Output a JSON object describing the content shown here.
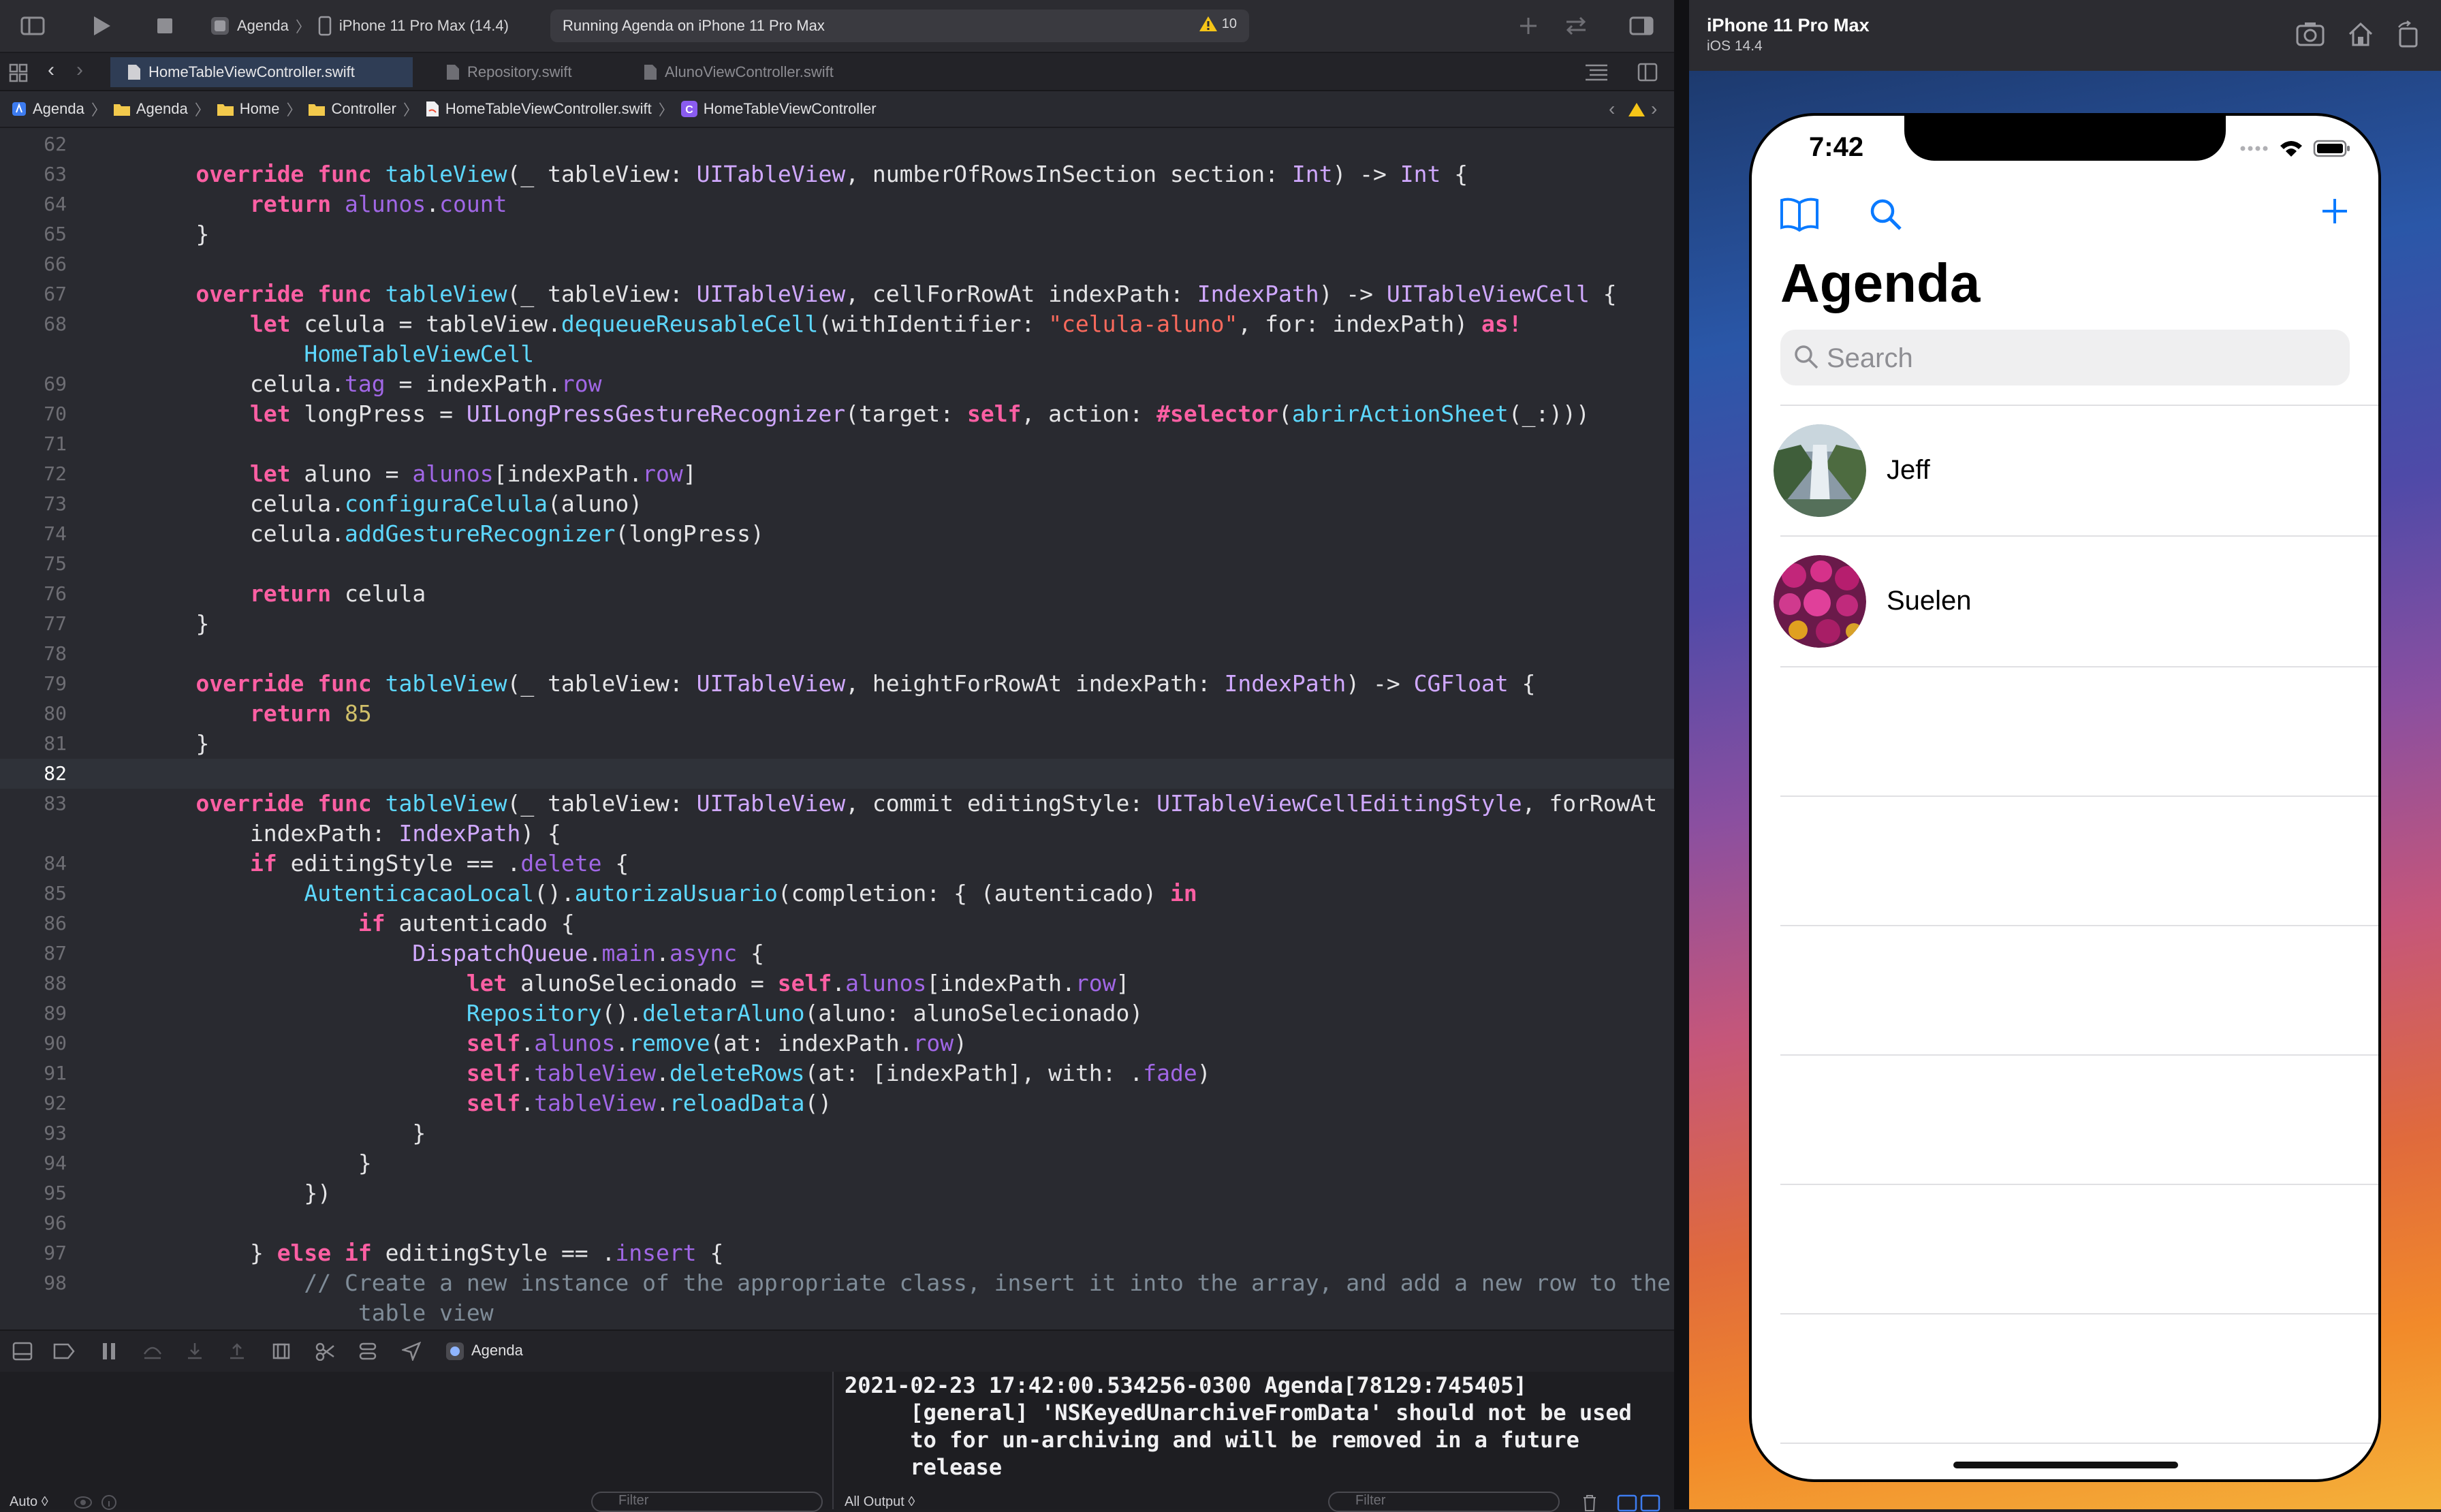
{
  "toolbar": {
    "scheme_project": "Agenda",
    "scheme_device": "iPhone 11 Pro Max (14.4)",
    "status": "Running Agenda on iPhone 11 Pro Max",
    "warning_count": "10"
  },
  "tabs": [
    {
      "label": "HomeTableViewController.swift"
    },
    {
      "label": "Repository.swift"
    },
    {
      "label": "AlunoViewController.swift"
    }
  ],
  "jumpbar": {
    "items": [
      "Agenda",
      "Agenda",
      "Home",
      "Controller",
      "HomeTableViewController.swift",
      "HomeTableViewController"
    ]
  },
  "debug": {
    "target": "Agenda"
  },
  "console": {
    "output": "2021-02-23 17:42:00.534256-0300 Agenda[78129:745405]\n     [general] 'NSKeyedUnarchiveFromData' should not be used\n     to for un-archiving and will be removed in a future\n     release",
    "left_scope": "Auto ◊",
    "right_scope": "All Output ◊",
    "filter_placeholder": "Filter"
  },
  "simulator": {
    "device": "iPhone 11 Pro Max",
    "os": "iOS 14.4",
    "time": "7:42",
    "title": "Agenda",
    "search_placeholder": "Search",
    "contacts": [
      {
        "name": "Jeff"
      },
      {
        "name": "Suelen"
      }
    ]
  },
  "colors": {
    "accent": "#0a7aff",
    "keyword": "#fc5fa3",
    "function": "#5dd8ff",
    "type": "#d0a8ff",
    "string": "#fc6a5d",
    "number": "#d0bf69",
    "comment": "#7f8c98"
  },
  "code_lines": [
    {
      "n": "62",
      "c": []
    },
    {
      "n": "63",
      "c": [
        [
          "",
          "    "
        ],
        [
          "kw",
          "override"
        ],
        [
          "",
          " "
        ],
        [
          "kw",
          "func"
        ],
        [
          "",
          " "
        ],
        [
          "fn",
          "tableView"
        ],
        [
          "",
          "(_ tableView: "
        ],
        [
          "ty",
          "UITableView"
        ],
        [
          "",
          ", numberOfRowsInSection section: "
        ],
        [
          "ty",
          "Int"
        ],
        [
          "",
          ") -> "
        ],
        [
          "ty",
          "Int"
        ],
        [
          "",
          " {"
        ]
      ]
    },
    {
      "n": "64",
      "c": [
        [
          "",
          "        "
        ],
        [
          "kw",
          "return"
        ],
        [
          "",
          " "
        ],
        [
          "pr",
          "alunos"
        ],
        [
          "",
          "."
        ],
        [
          "pr",
          "count"
        ]
      ]
    },
    {
      "n": "65",
      "c": [
        [
          "",
          "    }"
        ]
      ]
    },
    {
      "n": "66",
      "c": []
    },
    {
      "n": "67",
      "c": [
        [
          "",
          "    "
        ],
        [
          "kw",
          "override"
        ],
        [
          "",
          " "
        ],
        [
          "kw",
          "func"
        ],
        [
          "",
          " "
        ],
        [
          "fn",
          "tableView"
        ],
        [
          "",
          "(_ tableView: "
        ],
        [
          "ty",
          "UITableView"
        ],
        [
          "",
          ", cellForRowAt indexPath: "
        ],
        [
          "ty",
          "IndexPath"
        ],
        [
          "",
          ") -> "
        ],
        [
          "ty",
          "UITableViewCell"
        ],
        [
          "",
          " {"
        ]
      ]
    },
    {
      "n": "68",
      "c": [
        [
          "",
          "        "
        ],
        [
          "kw",
          "let"
        ],
        [
          "",
          " celula = tableView."
        ],
        [
          "fn",
          "dequeueReusableCell"
        ],
        [
          "",
          "(withIdentifier: "
        ],
        [
          "st",
          "\"celula-aluno\""
        ],
        [
          "",
          ", for: indexPath) "
        ],
        [
          "kw",
          "as!"
        ]
      ]
    },
    {
      "n": "",
      "c": [
        [
          "",
          "            "
        ],
        [
          "fn",
          "HomeTableViewCell"
        ]
      ]
    },
    {
      "n": "69",
      "c": [
        [
          "",
          "        celula."
        ],
        [
          "pr",
          "tag"
        ],
        [
          "",
          " = indexPath."
        ],
        [
          "pr",
          "row"
        ]
      ]
    },
    {
      "n": "70",
      "c": [
        [
          "",
          "        "
        ],
        [
          "kw",
          "let"
        ],
        [
          "",
          " longPress = "
        ],
        [
          "ty",
          "UILongPressGestureRecognizer"
        ],
        [
          "",
          "(target: "
        ],
        [
          "kw",
          "self"
        ],
        [
          "",
          ", action: "
        ],
        [
          "kw",
          "#selector"
        ],
        [
          "",
          "("
        ],
        [
          "fn",
          "abrirActionSheet"
        ],
        [
          "",
          "(_:)))"
        ]
      ]
    },
    {
      "n": "71",
      "c": []
    },
    {
      "n": "72",
      "c": [
        [
          "",
          "        "
        ],
        [
          "kw",
          "let"
        ],
        [
          "",
          " aluno = "
        ],
        [
          "pr",
          "alunos"
        ],
        [
          "",
          "[indexPath."
        ],
        [
          "pr",
          "row"
        ],
        [
          "",
          "]"
        ]
      ]
    },
    {
      "n": "73",
      "c": [
        [
          "",
          "        celula."
        ],
        [
          "fn",
          "configuraCelula"
        ],
        [
          "",
          "(aluno)"
        ]
      ]
    },
    {
      "n": "74",
      "c": [
        [
          "",
          "        celula."
        ],
        [
          "fn",
          "addGestureRecognizer"
        ],
        [
          "",
          "(longPress)"
        ]
      ]
    },
    {
      "n": "75",
      "c": []
    },
    {
      "n": "76",
      "c": [
        [
          "",
          "        "
        ],
        [
          "kw",
          "return"
        ],
        [
          "",
          " celula"
        ]
      ]
    },
    {
      "n": "77",
      "c": [
        [
          "",
          "    }"
        ]
      ]
    },
    {
      "n": "78",
      "c": []
    },
    {
      "n": "79",
      "c": [
        [
          "",
          "    "
        ],
        [
          "kw",
          "override"
        ],
        [
          "",
          " "
        ],
        [
          "kw",
          "func"
        ],
        [
          "",
          " "
        ],
        [
          "fn",
          "tableView"
        ],
        [
          "",
          "(_ tableView: "
        ],
        [
          "ty",
          "UITableView"
        ],
        [
          "",
          ", heightForRowAt indexPath: "
        ],
        [
          "ty",
          "IndexPath"
        ],
        [
          "",
          ") -> "
        ],
        [
          "ty",
          "CGFloat"
        ],
        [
          "",
          " {"
        ]
      ]
    },
    {
      "n": "80",
      "c": [
        [
          "",
          "        "
        ],
        [
          "kw",
          "return"
        ],
        [
          "",
          " "
        ],
        [
          "nm",
          "85"
        ]
      ]
    },
    {
      "n": "81",
      "c": [
        [
          "",
          "    }"
        ]
      ]
    },
    {
      "n": "82",
      "c": [],
      "current": true
    },
    {
      "n": "83",
      "c": [
        [
          "",
          "    "
        ],
        [
          "kw",
          "override"
        ],
        [
          "",
          " "
        ],
        [
          "kw",
          "func"
        ],
        [
          "",
          " "
        ],
        [
          "fn",
          "tableView"
        ],
        [
          "",
          "(_ tableView: "
        ],
        [
          "ty",
          "UITableView"
        ],
        [
          "",
          ", commit editingStyle: "
        ],
        [
          "ty",
          "UITableViewCellEditingStyle"
        ],
        [
          "",
          ", forRowAt"
        ]
      ]
    },
    {
      "n": "",
      "c": [
        [
          "",
          "        indexPath: "
        ],
        [
          "ty",
          "IndexPath"
        ],
        [
          "",
          ") {"
        ]
      ]
    },
    {
      "n": "84",
      "c": [
        [
          "",
          "        "
        ],
        [
          "kw",
          "if"
        ],
        [
          "",
          " editingStyle == ."
        ],
        [
          "pr",
          "delete"
        ],
        [
          "",
          " {"
        ]
      ]
    },
    {
      "n": "85",
      "c": [
        [
          "",
          "            "
        ],
        [
          "fn",
          "AutenticacaoLocal"
        ],
        [
          "",
          "()."
        ],
        [
          "fn",
          "autorizaUsuario"
        ],
        [
          "",
          "(completion: { (autenticado) "
        ],
        [
          "kw",
          "in"
        ]
      ]
    },
    {
      "n": "86",
      "c": [
        [
          "",
          "                "
        ],
        [
          "kw",
          "if"
        ],
        [
          "",
          " autenticado {"
        ]
      ]
    },
    {
      "n": "87",
      "c": [
        [
          "",
          "                    "
        ],
        [
          "ty",
          "DispatchQueue"
        ],
        [
          "",
          "."
        ],
        [
          "pr",
          "main"
        ],
        [
          "",
          "."
        ],
        [
          "pr",
          "async"
        ],
        [
          "",
          " {"
        ]
      ]
    },
    {
      "n": "88",
      "c": [
        [
          "",
          "                        "
        ],
        [
          "kw",
          "let"
        ],
        [
          "",
          " alunoSelecionado = "
        ],
        [
          "kw",
          "self"
        ],
        [
          "",
          "."
        ],
        [
          "pr",
          "alunos"
        ],
        [
          "",
          "[indexPath."
        ],
        [
          "pr",
          "row"
        ],
        [
          "",
          "]"
        ]
      ]
    },
    {
      "n": "89",
      "c": [
        [
          "",
          "                        "
        ],
        [
          "fn",
          "Repository"
        ],
        [
          "",
          "()."
        ],
        [
          "fn",
          "deletarAluno"
        ],
        [
          "",
          "(aluno: alunoSelecionado)"
        ]
      ]
    },
    {
      "n": "90",
      "c": [
        [
          "",
          "                        "
        ],
        [
          "kw",
          "self"
        ],
        [
          "",
          "."
        ],
        [
          "pr",
          "alunos"
        ],
        [
          "",
          "."
        ],
        [
          "fn",
          "remove"
        ],
        [
          "",
          "(at: indexPath."
        ],
        [
          "pr",
          "row"
        ],
        [
          "",
          ")"
        ]
      ]
    },
    {
      "n": "91",
      "c": [
        [
          "",
          "                        "
        ],
        [
          "kw",
          "self"
        ],
        [
          "",
          "."
        ],
        [
          "pr",
          "tableView"
        ],
        [
          "",
          "."
        ],
        [
          "fn",
          "deleteRows"
        ],
        [
          "",
          "(at: [indexPath], with: ."
        ],
        [
          "pr",
          "fade"
        ],
        [
          "",
          ")"
        ]
      ]
    },
    {
      "n": "92",
      "c": [
        [
          "",
          "                        "
        ],
        [
          "kw",
          "self"
        ],
        [
          "",
          "."
        ],
        [
          "pr",
          "tableView"
        ],
        [
          "",
          "."
        ],
        [
          "fn",
          "reloadData"
        ],
        [
          "",
          "()"
        ]
      ]
    },
    {
      "n": "93",
      "c": [
        [
          "",
          "                    }"
        ]
      ]
    },
    {
      "n": "94",
      "c": [
        [
          "",
          "                }"
        ]
      ]
    },
    {
      "n": "95",
      "c": [
        [
          "",
          "            })"
        ]
      ]
    },
    {
      "n": "96",
      "c": []
    },
    {
      "n": "97",
      "c": [
        [
          "",
          "        } "
        ],
        [
          "kw",
          "else"
        ],
        [
          "",
          " "
        ],
        [
          "kw",
          "if"
        ],
        [
          "",
          " editingStyle == ."
        ],
        [
          "pr",
          "insert"
        ],
        [
          "",
          " {"
        ]
      ]
    },
    {
      "n": "98",
      "c": [
        [
          "cm",
          "            // Create a new instance of the appropriate class, insert it into the array, and add a new row to the"
        ]
      ]
    },
    {
      "n": "",
      "c": [
        [
          "cm",
          "                table view"
        ]
      ]
    }
  ]
}
